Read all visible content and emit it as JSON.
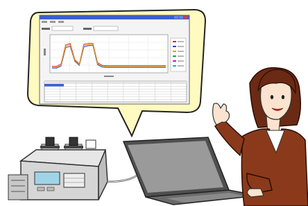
{
  "speech_bubble": {
    "fill": "#fffac0",
    "outline": "#222222"
  },
  "app_window": {
    "menu_items": [
      "",
      "",
      ""
    ],
    "toolbar_label": "",
    "chart_data": {
      "type": "line",
      "title": "",
      "xlabel": "",
      "ylabel": "",
      "series": [
        {
          "color": "#e02020",
          "values": [
            0.15,
            0.15,
            0.22,
            0.78,
            0.82,
            0.35,
            0.22,
            0.8,
            0.82,
            0.82,
            0.26,
            0.18,
            0.17,
            0.17,
            0.17,
            0.17,
            0.17,
            0.17,
            0.17,
            0.17,
            0.17,
            0.17,
            0.17,
            0.17,
            0.17,
            0.17
          ]
        },
        {
          "color": "#2040d0",
          "values": [
            0.1,
            0.1,
            0.16,
            0.7,
            0.74,
            0.3,
            0.18,
            0.72,
            0.76,
            0.76,
            0.2,
            0.13,
            0.12,
            0.12,
            0.12,
            0.12,
            0.12,
            0.12,
            0.12,
            0.12,
            0.12,
            0.12,
            0.12,
            0.12,
            0.12,
            0.12
          ]
        },
        {
          "color": "#e0a000",
          "values": [
            0.12,
            0.12,
            0.18,
            0.74,
            0.78,
            0.32,
            0.2,
            0.76,
            0.79,
            0.79,
            0.23,
            0.15,
            0.14,
            0.14,
            0.14,
            0.14,
            0.14,
            0.14,
            0.14,
            0.14,
            0.14,
            0.14,
            0.14,
            0.14,
            0.14,
            0.14
          ]
        }
      ],
      "legend_colors": [
        "#e02020",
        "#2040d0",
        "#e0a000",
        "#20a040",
        "#c020c0",
        "#20b0c0"
      ],
      "grid": true,
      "legend_position": "right"
    },
    "table": {
      "selected_row_color": "#3a5fd0",
      "rows": 6,
      "cols": 9
    }
  },
  "device": {
    "body_color": "#d8d8d8",
    "display_color": "#9fd4e8"
  },
  "laptop": {
    "screen_color": "#9a9a9a",
    "frame_color": "#5a5a5a"
  },
  "person": {
    "hair_color": "#6a2a14",
    "jacket_color": "#8a3a1a",
    "skin_color": "#fbe3cf"
  }
}
